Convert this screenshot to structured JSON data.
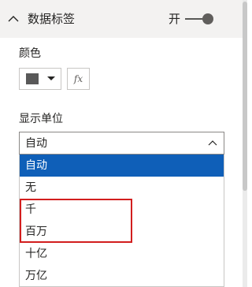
{
  "section": {
    "title": "数据标签",
    "toggle_label": "开",
    "toggle_on": true
  },
  "color": {
    "label": "颜色",
    "swatch_color": "#595959",
    "fx_label": "fx"
  },
  "display_units": {
    "label": "显示单位",
    "selected": "自动",
    "options": [
      "自动",
      "无",
      "千",
      "百万",
      "十亿",
      "万亿"
    ],
    "highlighted_options": [
      "千",
      "百万"
    ],
    "selected_color": "#0f5fb8",
    "highlight_color": "#d21e1e"
  }
}
